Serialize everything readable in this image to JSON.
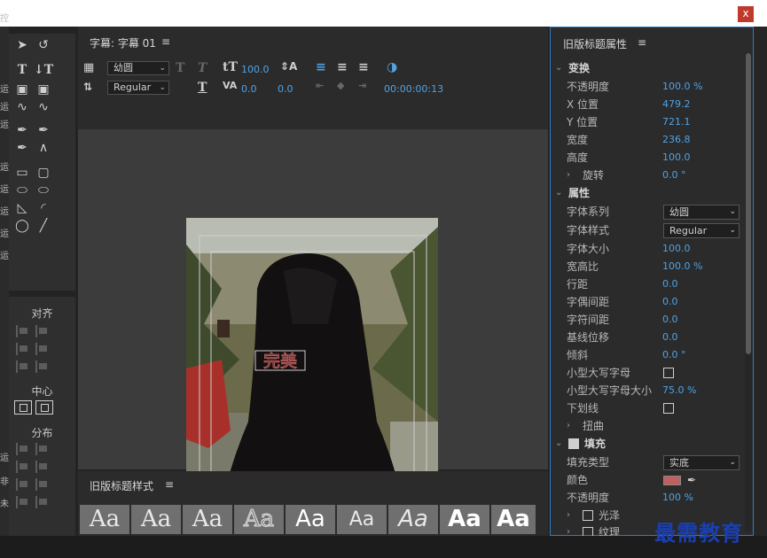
{
  "window": {
    "close_label": "x"
  },
  "left_strip": {
    "chars": [
      "控",
      "运",
      "运",
      "运",
      "运",
      "运",
      "运",
      "运",
      "运",
      "运",
      "非",
      "未"
    ]
  },
  "tools": {
    "align_label": "对齐",
    "center_label": "中心",
    "distribute_label": "分布"
  },
  "caption": {
    "title": "字幕: 字幕 01",
    "font_family": "幼圆",
    "font_style": "Regular",
    "font_size": "100.0",
    "kerning": "0.0",
    "tracking": "0.0",
    "timecode": "00:00:00:13",
    "overlay_text": "完美"
  },
  "styles": {
    "title": "旧版标题样式",
    "swatches": [
      "Aa",
      "Aa",
      "Aa",
      "Aa",
      "Aa",
      "Aa",
      "Aa",
      "Aa",
      "Aa"
    ]
  },
  "props": {
    "title": "旧版标题属性",
    "transform": {
      "header": "变换",
      "opacity_label": "不透明度",
      "opacity_value": "100.0 %",
      "x_label": "X 位置",
      "x_value": "479.2",
      "y_label": "Y 位置",
      "y_value": "721.1",
      "width_label": "宽度",
      "width_value": "236.8",
      "height_label": "高度",
      "height_value": "100.0",
      "rotation_label": "旋转",
      "rotation_value": "0.0 °"
    },
    "properties": {
      "header": "属性",
      "font_family_label": "字体系列",
      "font_family_value": "幼圆",
      "font_style_label": "字体样式",
      "font_style_value": "Regular",
      "font_size_label": "字体大小",
      "font_size_value": "100.0",
      "aspect_label": "宽高比",
      "aspect_value": "100.0 %",
      "leading_label": "行距",
      "leading_value": "0.0",
      "kerning_label": "字偶间距",
      "kerning_value": "0.0",
      "tracking_label": "字符间距",
      "tracking_value": "0.0",
      "baseline_label": "基线位移",
      "baseline_value": "0.0",
      "slant_label": "倾斜",
      "slant_value": "0.0 °",
      "smallcaps_label": "小型大写字母",
      "smallcaps_size_label": "小型大写字母大小",
      "smallcaps_size_value": "75.0 %",
      "underline_label": "下划线",
      "distort_label": "扭曲"
    },
    "fill": {
      "header": "填充",
      "fill_type_label": "填充类型",
      "fill_type_value": "实底",
      "color_label": "颜色",
      "color_hex": "#c0605e",
      "opacity_label": "不透明度",
      "opacity_value": "100 %",
      "sheen_label": "光泽",
      "texture_label": "纹理"
    }
  },
  "watermark": "最需教育"
}
